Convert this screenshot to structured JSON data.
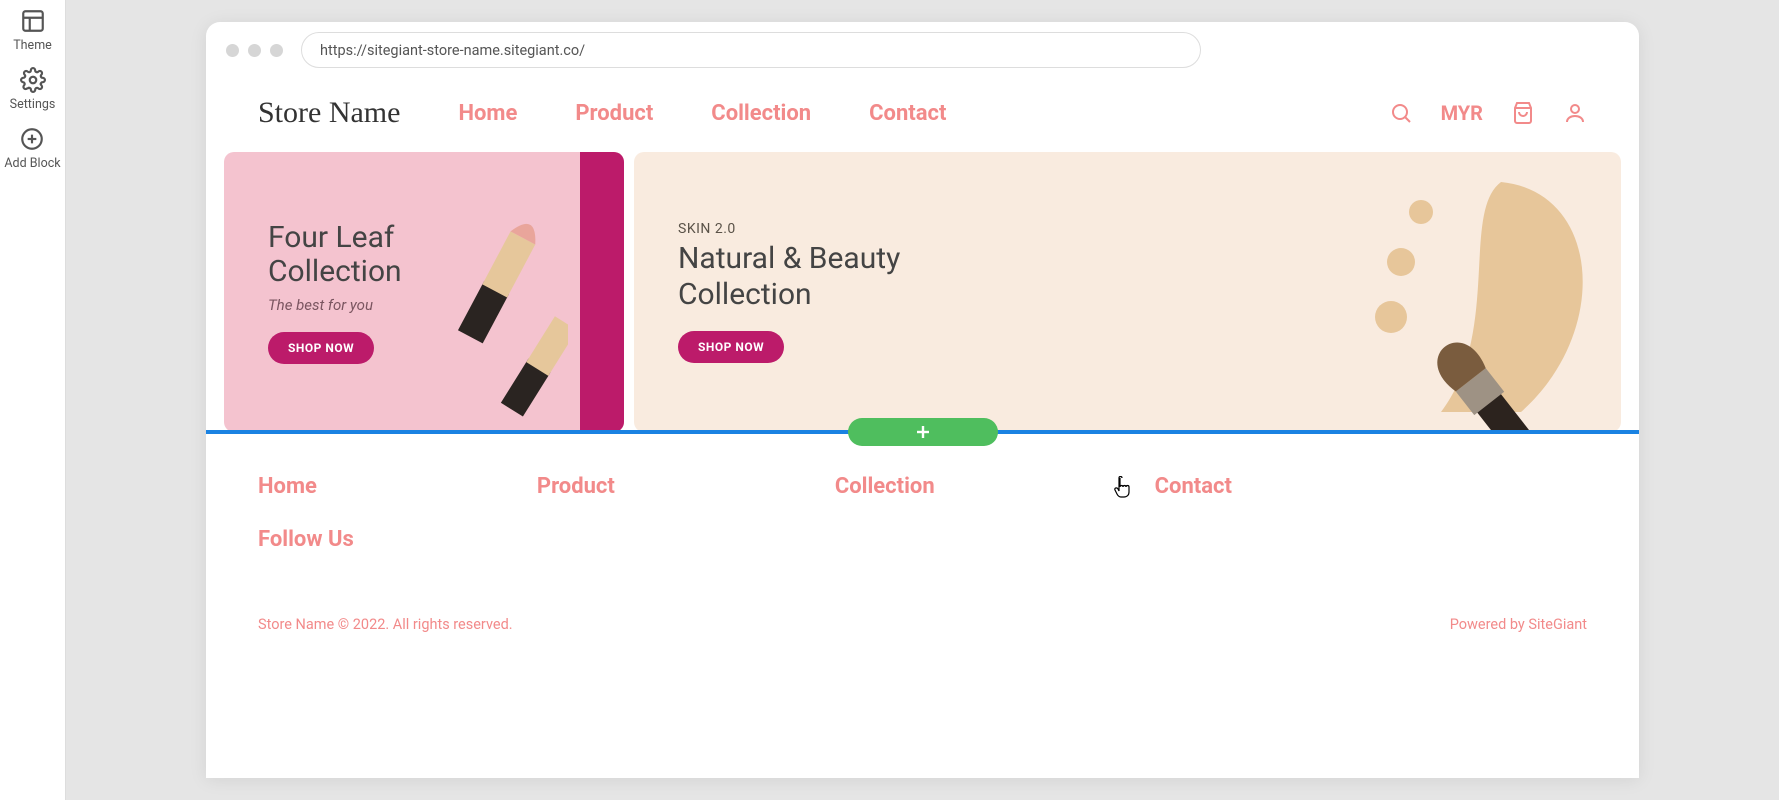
{
  "sidebar": {
    "theme": "Theme",
    "settings": "Settings",
    "add_block": "Add Block"
  },
  "browser": {
    "url": "https://sitegiant-store-name.sitegiant.co/"
  },
  "header": {
    "store_name": "Store Name",
    "currency": "MYR",
    "nav": [
      "Home",
      "Product",
      "Collection",
      "Contact"
    ]
  },
  "banners": {
    "left": {
      "title_line1": "Four Leaf",
      "title_line2": "Collection",
      "subtitle": "The best for you",
      "cta": "SHOP NOW"
    },
    "right": {
      "eyebrow": "SKIN 2.0",
      "title_line1": "Natural & Beauty",
      "title_line2": "Collection",
      "cta": "SHOP NOW"
    }
  },
  "footer": {
    "links": [
      "Home",
      "Product",
      "Collection",
      "Contact"
    ],
    "follow": "Follow Us",
    "copyright": "Store Name © 2022. All rights reserved.",
    "powered_prefix": "Powered by ",
    "powered_brand": "SiteGiant"
  }
}
